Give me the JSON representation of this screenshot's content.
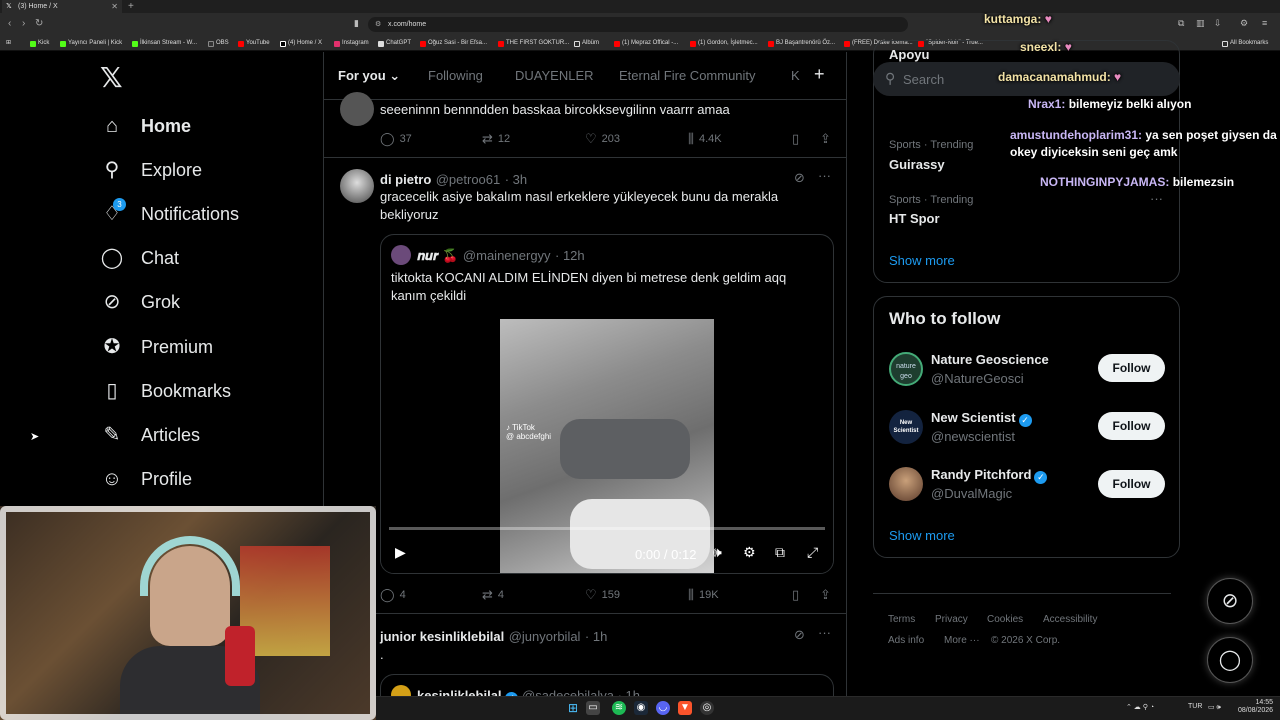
{
  "browser": {
    "tab_title": "(3) Home / X",
    "url": "x.com/home",
    "bookmarks": [
      "Kick",
      "Yayıncı Paneli | Kick",
      "İlkinsan Stream - W...",
      "OBS",
      "YouTube",
      "(4) Home / X",
      "Instagram",
      "ChatGPT",
      "Oğuz Sasi - Bir Efsa...",
      "THE FIRST GOKTUR...",
      "Albüm",
      "(1) Mepraz Offical -...",
      "(1) Gordon, İşletmec...",
      "BJ Başantrenörü Öz...",
      "(FREE) Drake Icema...",
      "\"Spider-Noir\" - True..."
    ],
    "all_bookmarks": "All Bookmarks"
  },
  "nav": {
    "items": [
      {
        "label": "Home",
        "icon": "home-icon"
      },
      {
        "label": "Explore",
        "icon": "search-icon"
      },
      {
        "label": "Notifications",
        "icon": "bell-icon",
        "badge": "3"
      },
      {
        "label": "Chat",
        "icon": "chat-icon"
      },
      {
        "label": "Grok",
        "icon": "grok-icon"
      },
      {
        "label": "Premium",
        "icon": "verified-badge-icon"
      },
      {
        "label": "Bookmarks",
        "icon": "bookmark-icon"
      },
      {
        "label": "Articles",
        "icon": "article-icon"
      },
      {
        "label": "Profile",
        "icon": "person-icon"
      }
    ]
  },
  "feed": {
    "tabs": [
      "For you",
      "Following",
      "DUAYENLER",
      "Eternal Fire Community",
      "K"
    ],
    "top_tweet": {
      "text": "seeeninnn bennndden basskaa bircokksevgilinn vaarrr amaa",
      "replies": "37",
      "reposts": "12",
      "likes": "203",
      "views": "4.4K"
    },
    "tweet": {
      "name": "di pietro",
      "handle": "@petroo61",
      "time": "· 3h",
      "text": "gracecelik asiye bakalım nasıl erkeklere yükleyecek bunu da merakla bekliyoruz",
      "quote": {
        "name": "𝒏𝒖𝒓 🍒",
        "handle": "@mainenergyy",
        "time": "· 12h",
        "text": "tiktokta KOCANI ALDIM ELİNDEN diyen bi metrese denk geldim aqq kanım çekildi",
        "video_time": "0:00 / 0:12",
        "watermark": "TikTok",
        "watermark_handle": "@ abcdefghi"
      },
      "replies": "4",
      "reposts": "4",
      "likes": "159",
      "views": "19K"
    },
    "third_tweet": {
      "name": "junior kesinliklebilal",
      "handle": "@junyorbilal",
      "time": "· 1h",
      "text": ".",
      "quote_name": "kesinliklebilal",
      "quote_handle": "@sadecebilalya · 1h"
    }
  },
  "sidebar": {
    "search_placeholder": "Search",
    "trend_partial": "Apoyu",
    "trends": [
      {
        "meta": "Sports · Trending",
        "title": "Guirassy"
      },
      {
        "meta": "Sports · Trending",
        "title": "HT Spor"
      }
    ],
    "show_more": "Show more",
    "who_to_follow": "Who to follow",
    "follow_label": "Follow",
    "accounts": [
      {
        "name": "Nature Geoscience",
        "handle": "@NatureGeosci",
        "verified": false,
        "avatar_text": "nature geo"
      },
      {
        "name": "New Scientist",
        "handle": "@newscientist",
        "verified": true,
        "avatar_text": "New Scientist"
      },
      {
        "name": "Randy Pitchford",
        "handle": "@DuvalMagic",
        "verified": true,
        "avatar_text": ""
      }
    ],
    "footer": [
      "Terms",
      "Privacy",
      "Cookies",
      "Accessibility",
      "Ads info",
      "More ···",
      "© 2026 X Corp."
    ]
  },
  "chat_overlay": [
    {
      "user": "kuttamga:",
      "msg": ""
    },
    {
      "user": "sneexl:",
      "msg": ""
    },
    {
      "user": "damacanamahmud:",
      "msg": ""
    },
    {
      "user": "Nrax1:",
      "msg": "bilemeyiz belki alıyon"
    },
    {
      "user": "amustundehoplarim31:",
      "msg": "ya sen poşet giysen da okey diyiceksin seni geç amk"
    },
    {
      "user": "NOTHINGINPYJAMAS:",
      "msg": "bilemezsin"
    }
  ],
  "taskbar": {
    "lang": "TUR",
    "time": "14:55",
    "date": "08/08/2026"
  },
  "colors": {
    "accent": "#1d9bf0",
    "bg": "#000000",
    "border": "#2f3336",
    "muted": "#71767b"
  }
}
